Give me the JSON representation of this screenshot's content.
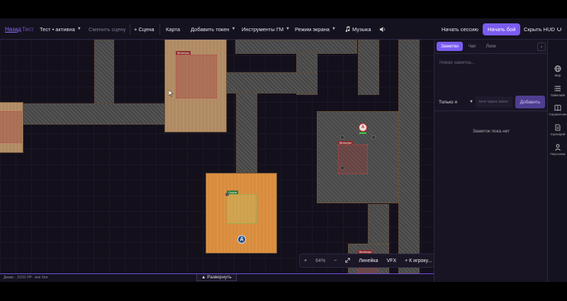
{
  "topbar": {
    "back": "Назад",
    "test": "Тест",
    "scene_select": "Тест • активна",
    "change_scene": "Сменить сцену",
    "add_scene": "+ Сцена",
    "map": "Карта",
    "add_token": "Добавить токен",
    "gm_tools": "Инструменты ГМ",
    "screen_mode": "Режим экрана",
    "music": "Музыка",
    "start_session": "Начать сессию",
    "start_fight": "Начать бой",
    "hide_hud": "Скрыть HUD"
  },
  "map": {
    "zones": {
      "monsters_1": "Монстры",
      "monsters_2": "Монстры",
      "monsters_3": "Монстры",
      "allies": "Союзн"
    },
    "tokens": {
      "token_a": "А",
      "token_d": "Д"
    }
  },
  "zoombar": {
    "plus": "+",
    "zoom": "64%",
    "minus": "−",
    "ruler": "Линейка",
    "vfx": "VFX",
    "to_player": "+ К игроку..."
  },
  "bottombar": {
    "status": "Джавс · 31/31 HP · вне боя",
    "expand": "▲ Развернуть"
  },
  "panel": {
    "tabs": {
      "notes": "Заметки",
      "chat": "Чат",
      "logs": "Логи"
    },
    "note_placeholder": "Новая заметка...",
    "visibility": "Только я",
    "tags_placeholder": "теги через запят",
    "add_button": "Добавить",
    "empty": "Заметок пока нет"
  },
  "rail": {
    "world": "Мир",
    "timeline": "Таймлайн",
    "reference": "Справочник",
    "scenarios": "Сценарий",
    "characters": "Персонаж"
  },
  "colors": {
    "accent": "#7b5cf0",
    "bg": "#14101f",
    "panel": "#181423"
  }
}
